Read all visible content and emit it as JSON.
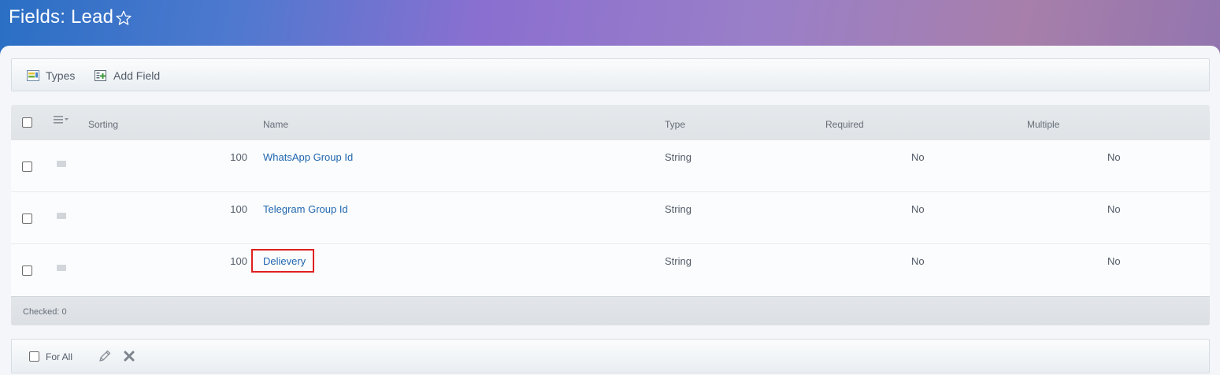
{
  "header": {
    "title": "Fields: Lead",
    "favorite_icon": "star-outline-icon"
  },
  "toolbar": {
    "types_label": "Types",
    "types_icon": "types-list-icon",
    "add_field_label": "Add Field",
    "add_field_icon": "add-field-icon"
  },
  "grid": {
    "columns": {
      "settings_icon": "column-settings-icon",
      "sorting": "Sorting",
      "name": "Name",
      "type": "Type",
      "required": "Required",
      "multiple": "Multiple"
    },
    "rows": [
      {
        "sorting": "100",
        "name": "WhatsApp Group Id",
        "type": "String",
        "required": "No",
        "multiple": "No"
      },
      {
        "sorting": "100",
        "name": "Telegram Group Id",
        "type": "String",
        "required": "No",
        "multiple": "No"
      },
      {
        "sorting": "100",
        "name": "Delievery",
        "type": "String",
        "required": "No",
        "multiple": "No",
        "highlighted": true
      }
    ],
    "checked_label": "Checked: 0"
  },
  "actions": {
    "for_all_label": "For All",
    "edit_icon": "pencil-icon",
    "delete_icon": "delete-x-icon"
  },
  "colors": {
    "link": "#2067b0",
    "highlight": "#e02020",
    "text": "#535c69"
  }
}
